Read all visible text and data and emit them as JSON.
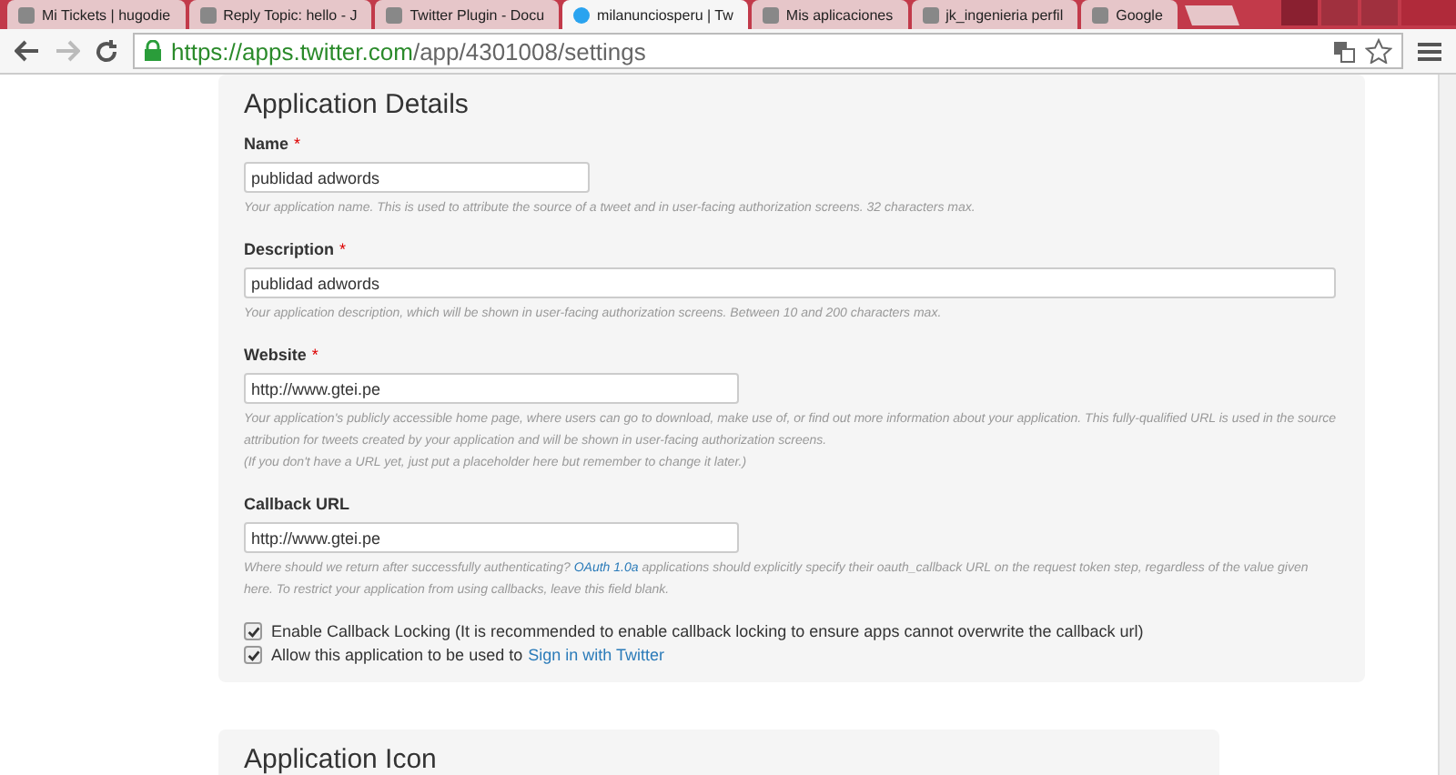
{
  "browser": {
    "tabs": [
      {
        "title": "Mi Tickets | hugodie",
        "selected": false
      },
      {
        "title": "Reply Topic: hello - J",
        "selected": false
      },
      {
        "title": "Twitter Plugin - Docu",
        "selected": false
      },
      {
        "title": "milanunciosperu | Tw",
        "selected": true
      },
      {
        "title": "Mis aplicaciones",
        "selected": false
      },
      {
        "title": "jk_ingenieria perfil",
        "selected": false
      },
      {
        "title": "Google",
        "selected": false
      }
    ],
    "url": {
      "host": "https://apps.twitter.com",
      "path": "/app/4301008/settings"
    }
  },
  "details": {
    "title": "Application Details",
    "fields": [
      {
        "label": "Name",
        "required_mark": "*",
        "value": "publidad adwords",
        "hint": [
          "Your application name. This is used to attribute the source of a tweet and in user-facing authorization screens. 32 characters max."
        ]
      },
      {
        "label": "Description",
        "required_mark": "*",
        "value": "publidad adwords",
        "hint": [
          "Your application description, which will be shown in user-facing authorization screens. Between 10 and 200 characters max."
        ]
      },
      {
        "label": "Website",
        "required_mark": "*",
        "value": "http://www.gtei.pe",
        "hint": [
          "Your application's publicly accessible home page, where users can go to download, make use of, or find out more information about your application. This fully-qualified URL is used in the source attribution for tweets created by your application and will be shown in user-facing authorization screens.",
          "(If you don't have a URL yet, just put a placeholder here but remember to change it later.)"
        ]
      },
      {
        "label": "Callback URL",
        "value": "http://www.gtei.pe",
        "hint_parts": {
          "before": "Where should we return after successfully authenticating?",
          "link": "OAuth 1.0a",
          "after": "applications should explicitly specify their oauth_callback URL on the request token step, regardless of the value given here. To restrict your application from using callbacks, leave this field blank."
        }
      }
    ],
    "checkboxes": [
      {
        "before": "Enable Callback Locking (It is recommended to enable callback locking to ensure apps cannot overwrite the callback url)",
        "checked": true
      },
      {
        "before": "Allow this application to be used to",
        "link": "Sign in with Twitter",
        "checked": true
      }
    ]
  },
  "icon_section": {
    "title": "Application Icon"
  }
}
